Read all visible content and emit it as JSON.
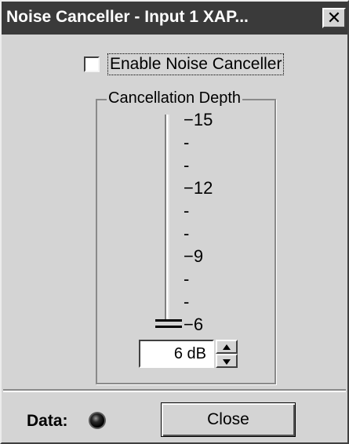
{
  "window": {
    "title": "Noise Canceller - Input 1  XAP...",
    "close_glyph": "✕"
  },
  "enable_checkbox": {
    "label": "Enable Noise Canceller",
    "checked": false
  },
  "cancellation_depth": {
    "group_title": "Cancellation Depth",
    "scale_min": 6,
    "scale_max": 15,
    "current_value": 6,
    "tick_labels": [
      "−15",
      "-",
      "-",
      "−12",
      "-",
      "-",
      "−9",
      "-",
      "-",
      "−6"
    ],
    "spin_value": "6 dB"
  },
  "footer": {
    "data_label": "Data:",
    "close_label": "Close"
  },
  "icons": {
    "title_close": "close-icon",
    "spin_up": "arrow-up-icon",
    "spin_down": "arrow-down-icon",
    "data_led": "led-indicator-icon"
  }
}
